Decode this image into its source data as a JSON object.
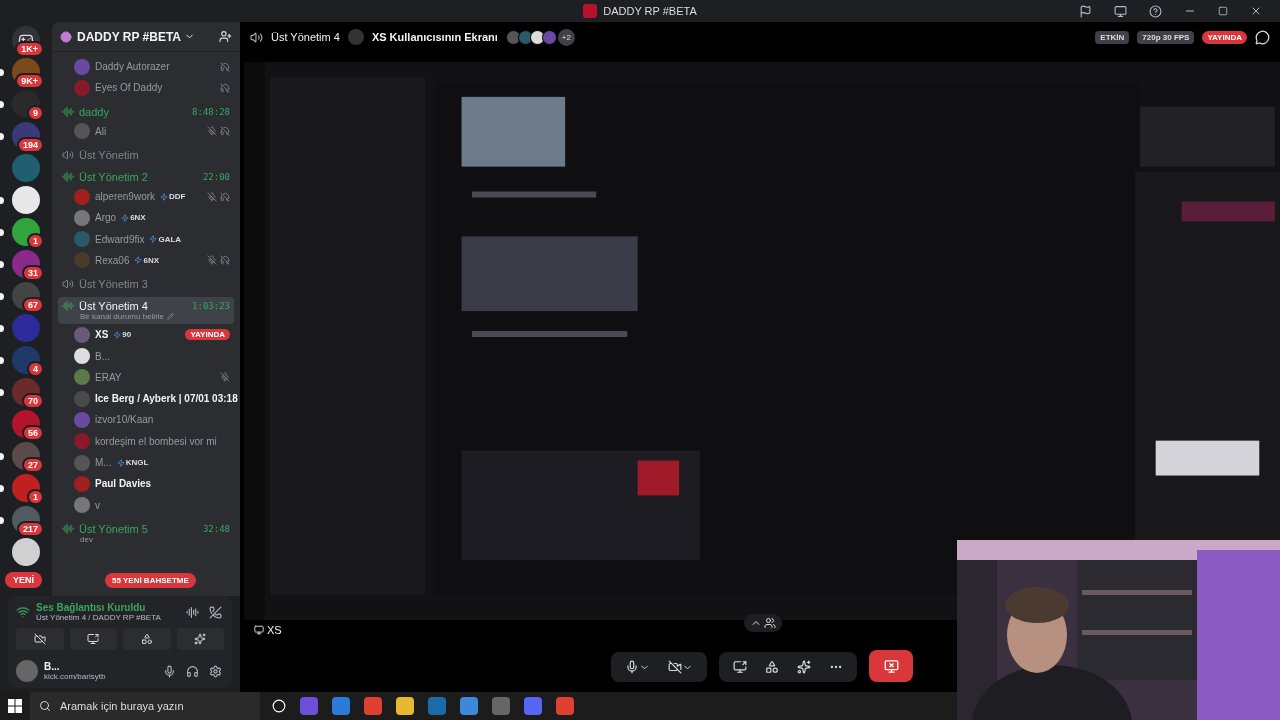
{
  "window": {
    "title": "DADDY RP #BETA"
  },
  "servers": [
    {
      "badge": "1K+",
      "unread": false,
      "kind": "home"
    },
    {
      "badge": "9K+",
      "unread": true,
      "kind": "server"
    },
    {
      "badge": "9",
      "unread": true,
      "kind": "server"
    },
    {
      "badge": "194",
      "unread": true,
      "kind": "server"
    },
    {
      "unread": false,
      "kind": "server"
    },
    {
      "unread": true,
      "kind": "server"
    },
    {
      "badge": "1",
      "unread": true,
      "kind": "server"
    },
    {
      "badge": "31",
      "unread": true,
      "kind": "server"
    },
    {
      "badge": "67",
      "unread": true,
      "kind": "server"
    },
    {
      "unread": true,
      "kind": "server"
    },
    {
      "badge": "4",
      "unread": true,
      "kind": "server"
    },
    {
      "badge": "70",
      "unread": true,
      "kind": "server"
    },
    {
      "badge": "56",
      "unread": false,
      "kind": "server"
    },
    {
      "badge": "27",
      "unread": true,
      "kind": "server"
    },
    {
      "badge": "1",
      "unread": true,
      "kind": "server"
    },
    {
      "badge": "217",
      "unread": true,
      "kind": "server"
    },
    {
      "unread": false,
      "kind": "server"
    }
  ],
  "new_pill": "YENİ",
  "guild": {
    "name": "DADDY RP #BETA"
  },
  "top_members": [
    {
      "name": "Daddy Autorazer",
      "muted": false,
      "deafened": true,
      "bright": false
    },
    {
      "name": "Eyes Of Daddy",
      "muted": false,
      "deafened": true,
      "bright": false
    }
  ],
  "channels": [
    {
      "name": "daddy",
      "active": true,
      "selected": false,
      "timer": "8:48:28",
      "children": [
        {
          "name": "Ali",
          "muted": true,
          "deafened": true,
          "bright": false
        }
      ]
    },
    {
      "name": "Üst Yönetim",
      "active": false,
      "selected": false
    },
    {
      "name": "Üst Yönetim 2",
      "active": true,
      "selected": false,
      "timer": "22:00",
      "children": [
        {
          "name": "alperen9work",
          "tag": "DDF",
          "muted": true,
          "deafened": true,
          "bright": false
        },
        {
          "name": "Argo",
          "tag": "6NX",
          "muted": false,
          "deafened": false,
          "bright": false
        },
        {
          "name": "Edward9fix",
          "tag": "GALA",
          "muted": false,
          "deafened": false,
          "bright": false
        },
        {
          "name": "Rexa06",
          "tag": "6NX",
          "muted": true,
          "deafened": true,
          "bright": false
        }
      ]
    },
    {
      "name": "Üst Yönetim 3",
      "active": false,
      "selected": false
    },
    {
      "name": "Üst Yönetim 4",
      "active": true,
      "selected": true,
      "timer": "1:03:23",
      "status": "Bir kanal durumu belirle",
      "children": [
        {
          "name": "XS",
          "tag": "90",
          "live": "YAYINDA",
          "muted": false,
          "deafened": false,
          "bright": true
        },
        {
          "name": "B...",
          "muted": false,
          "deafened": false,
          "bright": false
        },
        {
          "name": "ERAY",
          "muted": true,
          "deafened": false,
          "bright": false
        },
        {
          "name": "Ice Berg / Ayberk | 07/01 03:18",
          "muted": false,
          "deafened": false,
          "bright": true
        },
        {
          "name": "izvor10/Kaan",
          "muted": false,
          "deafened": false,
          "bright": false
        },
        {
          "name": "kordeşim el bombesi vor mi",
          "muted": false,
          "deafened": false,
          "bright": false
        },
        {
          "name": "M...",
          "tag": "KNGL",
          "muted": false,
          "deafened": false,
          "bright": false
        },
        {
          "name": "Paul Davies",
          "muted": false,
          "deafened": false,
          "bright": true
        },
        {
          "name": "v",
          "muted": false,
          "deafened": false,
          "bright": false
        }
      ]
    },
    {
      "name": "Üst Yönetim 5",
      "active": true,
      "selected": false,
      "timer": "32:48",
      "status": "dev"
    }
  ],
  "mentions_pill": "55 YENİ BAHSETME",
  "voice_panel": {
    "title": "Ses Bağlantısı Kuruldu",
    "subtitle": "Üst Yönetim 4 / DADDY RP #BETA"
  },
  "user": {
    "name": "B...",
    "status": "kick.com/barisytb"
  },
  "stream_header": {
    "channel": "Üst Yönetim 4",
    "title": "XS Kullanıcısının Ekranı",
    "extra": "+2",
    "activity": "ETKİN",
    "quality": "720p 30 FPS",
    "live": "YAYINDA"
  },
  "stream": {
    "kind": "picture",
    "streamer": "XS"
  },
  "taskbar": {
    "search": {
      "placeholder": "Aramak için buraya yazın"
    }
  }
}
